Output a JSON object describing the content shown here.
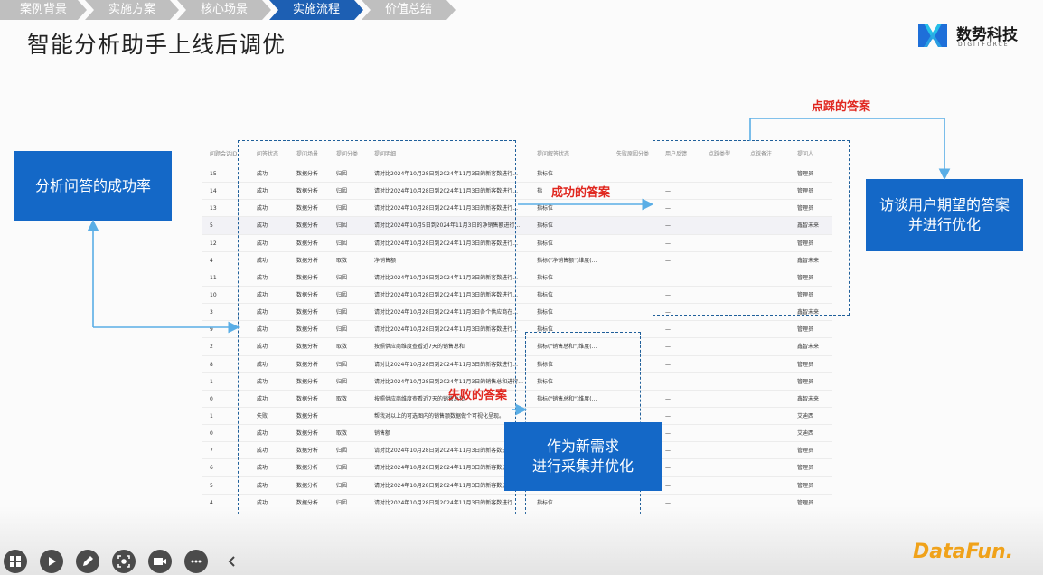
{
  "breadcrumbs": [
    {
      "label": "案例背景",
      "active": false
    },
    {
      "label": "实施方案",
      "active": false
    },
    {
      "label": "核心场景",
      "active": false
    },
    {
      "label": "实施流程",
      "active": true
    },
    {
      "label": "价值总结",
      "active": false
    }
  ],
  "slide": {
    "title": "智能分析助手上线后调优"
  },
  "logo": {
    "name": "数势科技",
    "sub": "DIGITFORCE",
    "colors": {
      "primary": "#1e6fd9",
      "secondary": "#25c0e8"
    }
  },
  "boxes": {
    "success_rate": "分析问答的成功率",
    "interview": [
      "访谈用户期望的答案",
      "并进行优化"
    ],
    "new_demand": [
      "作为新需求",
      "进行采集并优化"
    ]
  },
  "labels": {
    "likes": "点踩的答案",
    "success": "成功的答案",
    "failure": "失败的答案"
  },
  "table": {
    "headers": [
      "问题会话ID",
      "问答状态",
      "提问场景",
      "提问分类",
      "提问明细",
      "提问解答状态",
      "失败原因分类",
      "用户反馈",
      "点踩类型",
      "点踩备注",
      "提问人"
    ],
    "rows": [
      [
        "15",
        "成功",
        "数据分析",
        "归因",
        "请对比2024年10月28日到2024年11月3日的新客数进行...",
        "指标位",
        "—",
        "管理员"
      ],
      [
        "14",
        "成功",
        "数据分析",
        "归因",
        "请对比2024年10月28日到2024年11月3日的新客数进行...",
        "指",
        "—",
        "管理员"
      ],
      [
        "13",
        "成功",
        "数据分析",
        "归因",
        "请对比2024年10月28日到2024年11月3日的新客数进行...",
        "指标位",
        "—",
        "管理员"
      ],
      [
        "5",
        "成功",
        "数据分析",
        "归因",
        "请对比2024年10月5日到2024年11月3日的净销售额进行...",
        "指标位",
        "—",
        "鑫智未来"
      ],
      [
        "12",
        "成功",
        "数据分析",
        "归因",
        "请对比2024年10月28日到2024年11月3日的新客数进行...",
        "指标位",
        "—",
        "管理员"
      ],
      [
        "4",
        "成功",
        "数据分析",
        "取数",
        "净销售额",
        "指标(\"净销售额\")维度(...",
        "—",
        "鑫智未来"
      ],
      [
        "11",
        "成功",
        "数据分析",
        "归因",
        "请对比2024年10月28日到2024年11月3日的新客数进行...",
        "指标位",
        "—",
        "管理员"
      ],
      [
        "10",
        "成功",
        "数据分析",
        "归因",
        "请对比2024年10月28日到2024年11月3日的新客数进行...",
        "指标位",
        "—",
        "管理员"
      ],
      [
        "3",
        "成功",
        "数据分析",
        "归因",
        "请对比2024年10月28日到2024年11月3日各个供应商在...",
        "指标位",
        "—",
        "鑫智未来"
      ],
      [
        "9",
        "成功",
        "数据分析",
        "归因",
        "请对比2024年10月28日到2024年11月3日的新客数进行...",
        "指标位",
        "—",
        "管理员"
      ],
      [
        "2",
        "成功",
        "数据分析",
        "取数",
        "按照供应商维度查看近7天的销售总和",
        "指标(\"销售总和\")维度(...",
        "—",
        "鑫智未来"
      ],
      [
        "8",
        "成功",
        "数据分析",
        "归因",
        "请对比2024年10月28日到2024年11月3日的新客数进行...",
        "指标位",
        "—",
        "管理员"
      ],
      [
        "1",
        "成功",
        "数据分析",
        "归因",
        "请对比2024年10月28日到2024年11月3日的销售总和进行...",
        "指标位",
        "—",
        "管理员"
      ],
      [
        "0",
        "成功",
        "数据分析",
        "取数",
        "按照供应商维度查看近7天的销售总和",
        "指标(\"销售总和\")维度(...",
        "—",
        "鑫智未来"
      ],
      [
        "1",
        "失败",
        "数据分析",
        "",
        "帮我对以上的可选图内的销售额数据做个可视化呈现。",
        "",
        "—",
        "艾迪西"
      ],
      [
        "0",
        "成功",
        "数据分析",
        "取数",
        "销售额",
        "",
        "—",
        "艾迪西"
      ],
      [
        "7",
        "成功",
        "数据分析",
        "归因",
        "请对比2024年10月28日到2024年11月3日的新客数进行...",
        "",
        "—",
        "管理员"
      ],
      [
        "6",
        "成功",
        "数据分析",
        "归因",
        "请对比2024年10月28日到2024年11月3日的新客数进行...",
        "",
        "—",
        "管理员"
      ],
      [
        "5",
        "成功",
        "数据分析",
        "归因",
        "请对比2024年10月28日到2024年11月3日的新客数进行...",
        "",
        "—",
        "管理员"
      ],
      [
        "4",
        "成功",
        "数据分析",
        "归因",
        "请对比2024年10月28日到2024年11月3日的新客数进行...",
        "指标位",
        "—",
        "管理员"
      ]
    ]
  },
  "toolbar": [
    "grid-icon",
    "play-icon",
    "pen-icon",
    "screenshot-icon",
    "camera-icon",
    "more-icon",
    "back-icon"
  ],
  "brand": {
    "name": "DataFun.",
    "color": "#f0a21a"
  },
  "colors": {
    "accent_blue": "#1468c7",
    "label_red": "#e0271f",
    "dash_blue": "#1f5f9a"
  }
}
